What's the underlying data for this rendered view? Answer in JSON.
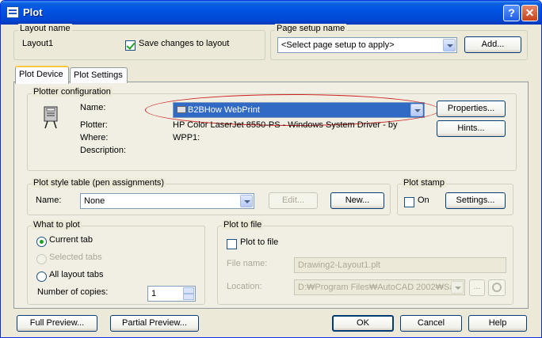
{
  "window": {
    "title": "Plot",
    "help_glyph": "?",
    "close_glyph": "✕"
  },
  "layout_name": {
    "legend": "Layout name",
    "value": "Layout1",
    "save_label": "Save changes to layout",
    "save_checked": true
  },
  "page_setup": {
    "legend": "Page setup name",
    "value": "<Select page setup to apply>",
    "add_label": "Add..."
  },
  "tabs": [
    {
      "label": "Plot Device",
      "active": true
    },
    {
      "label": "Plot Settings",
      "active": false
    }
  ],
  "plotter": {
    "legend": "Plotter configuration",
    "name_label": "Name:",
    "name_value": "B2BHow WebPrint",
    "plotter_label": "Plotter:",
    "plotter_value": "HP Color LaserJet 8550-PS - Windows System Driver - by",
    "where_label": "Where:",
    "where_value": "WPP1:",
    "description_label": "Description:",
    "properties_label": "Properties...",
    "hints_label": "Hints...",
    "highlight_color": "#cc2222"
  },
  "plot_style": {
    "legend": "Plot style table (pen assignments)",
    "name_label": "Name:",
    "name_value": "None",
    "edit_label": "Edit...",
    "new_label": "New..."
  },
  "plot_stamp": {
    "legend": "Plot stamp",
    "on_label": "On",
    "settings_label": "Settings..."
  },
  "what_to_plot": {
    "legend": "What to plot",
    "options": [
      {
        "label": "Current tab",
        "checked": true,
        "enabled": true
      },
      {
        "label": "Selected tabs",
        "checked": false,
        "enabled": false
      },
      {
        "label": "All layout tabs",
        "checked": false,
        "enabled": true
      }
    ],
    "copies_label": "Number of copies:",
    "copies_value": "1"
  },
  "plot_to_file": {
    "legend": "Plot to file",
    "checkbox_label": "Plot to file",
    "file_name_label": "File name:",
    "file_name_value": "Drawing2-Layout1.plt",
    "location_label": "Location:",
    "location_value": "D:₩Program Files₩AutoCAD 2002₩Sa",
    "browse_label": "..."
  },
  "footer": {
    "full_preview": "Full Preview...",
    "partial_preview": "Partial Preview...",
    "ok": "OK",
    "cancel": "Cancel",
    "help": "Help"
  }
}
